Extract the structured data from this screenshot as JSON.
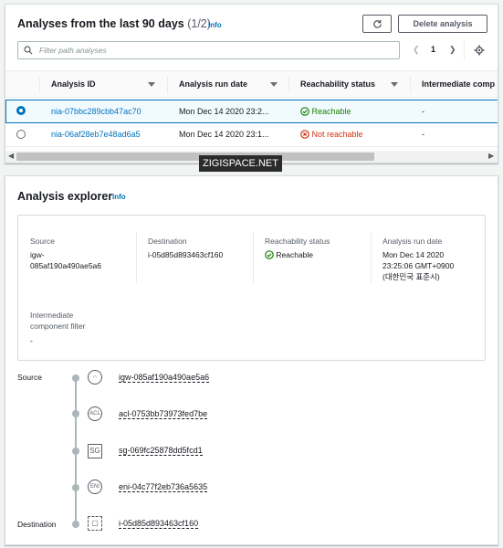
{
  "analyses": {
    "title": "Analyses from the last 90 days",
    "count": "(1/2)",
    "info": "Info",
    "delete_label": "Delete analysis",
    "search_placeholder": "Filter path analyses",
    "page": "1",
    "columns": [
      "Analysis ID",
      "Analysis run date",
      "Reachability status",
      "Intermediate comp"
    ],
    "rows": [
      {
        "id": "nia-07bbc289cbb47ac70",
        "date": "Mon Dec 14 2020 23:2...",
        "status": "Reachable",
        "intermediate": "-",
        "selected": true
      },
      {
        "id": "nia-06af28eb7e48ad6a5",
        "date": "Mon Dec 14 2020 23:1...",
        "status": "Not reachable",
        "intermediate": "-",
        "selected": false
      }
    ]
  },
  "watermark": "ZIGISPACE.NET",
  "explorer": {
    "title": "Analysis explorer",
    "info": "Info",
    "summary": {
      "source_label": "Source",
      "source_value": [
        "igw-",
        "085af190a490ae5a6"
      ],
      "destination_label": "Destination",
      "destination_value": "i-05d85d893463cf160",
      "status_label": "Reachability status",
      "status_value": "Reachable",
      "run_date_label": "Analysis run date",
      "run_date_value": [
        "Mon Dec 14 2020",
        "23:25:06 GMT+0900",
        "(대한민국 표준시)"
      ],
      "filter_label": [
        "Intermediate",
        "component filter"
      ],
      "filter_value": "-"
    },
    "path": {
      "source_label": "Source",
      "destination_label": "Destination",
      "nodes": [
        {
          "icon": "igw-icon",
          "glyph": "∩",
          "id": "igw-085af190a490ae5a6"
        },
        {
          "icon": "acl-icon",
          "glyph": "ACL",
          "id": "acl-0753bb73973fed7be"
        },
        {
          "icon": "security-group-icon",
          "glyph": "SG",
          "id": "sg-069fc25878dd5fcd1"
        },
        {
          "icon": "eni-icon",
          "glyph": "ENI",
          "id": "eni-04c77f2eb736a5635"
        },
        {
          "icon": "instance-icon",
          "glyph": "▢",
          "id": "i-05d85d893463cf160"
        }
      ]
    }
  },
  "colors": {
    "link": "#0073bb",
    "success": "#1d8102",
    "error": "#d13212",
    "border": "#d5dbdb"
  }
}
